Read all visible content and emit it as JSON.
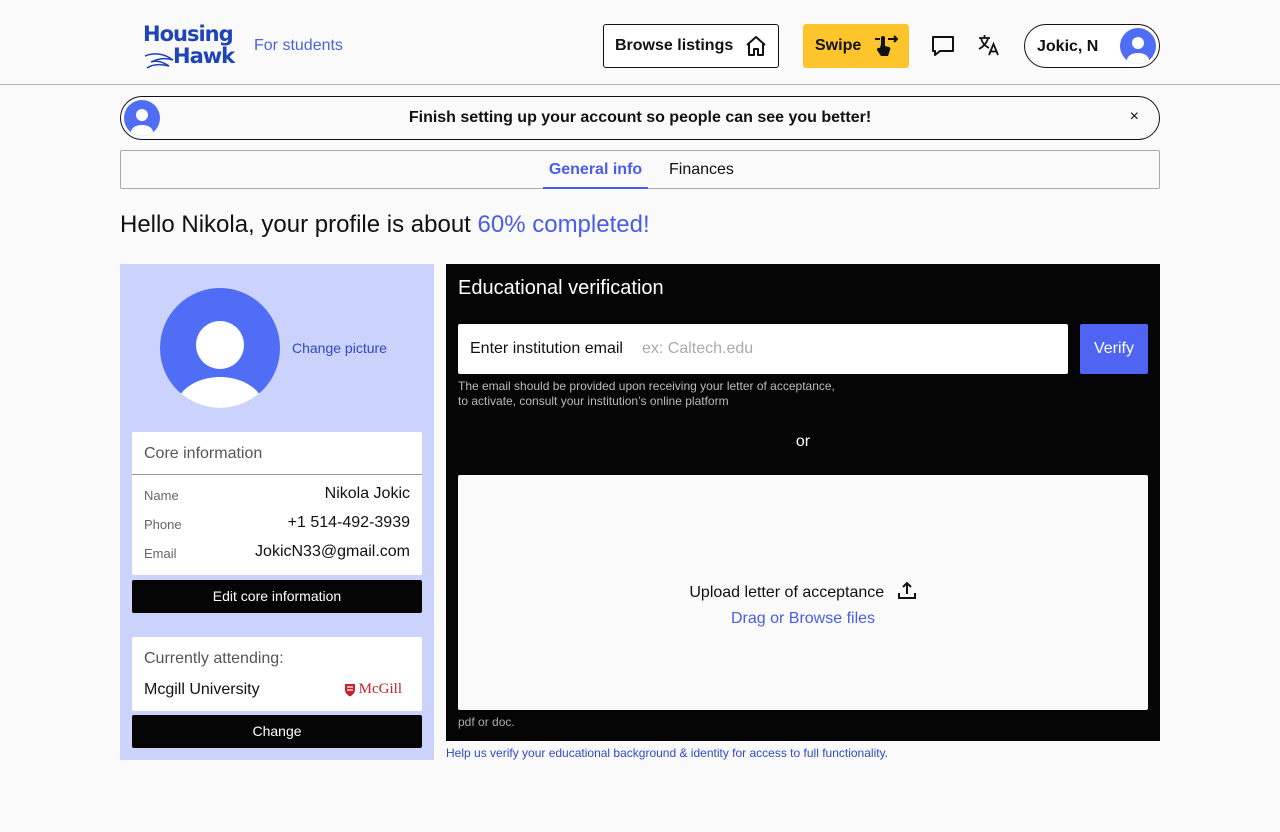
{
  "header": {
    "logo_line1": "Housing",
    "logo_line2": "Hawk",
    "tagline": "For students",
    "browse_label": "Browse listings",
    "swipe_label": "Swipe",
    "user_name": "Jokic, N"
  },
  "banner": {
    "text": "Finish setting up your account so people can see you better!",
    "close": "×"
  },
  "tabs": [
    {
      "label": "General info",
      "active": true
    },
    {
      "label": "Finances",
      "active": false
    }
  ],
  "greeting": {
    "prefix": "Hello Nikola, your profile is about ",
    "highlight": "60% completed!"
  },
  "profile": {
    "change_picture": "Change picture",
    "core_title": "Core information",
    "fields": [
      {
        "key": "Name",
        "value": "Nikola Jokic"
      },
      {
        "key": "Phone",
        "value": "+1 514-492-3939"
      },
      {
        "key": "Email",
        "value": "JokicN33@gmail.com"
      }
    ],
    "edit_button": "Edit core information",
    "attending_title": "Currently attending:",
    "university": "Mcgill University",
    "university_logo_text": "McGill",
    "change_button": "Change"
  },
  "verification": {
    "title": "Educational verification",
    "email_label": "Enter institution email",
    "email_placeholder": "ex: Caltech.edu",
    "verify_button": "Verify",
    "hint_line1": "The email should be provided upon receiving your letter of acceptance,",
    "hint_line2": "to activate, consult your institution’s online platform",
    "or": "or",
    "upload_label": "Upload letter of acceptance",
    "upload_link": "Drag or Browse files",
    "file_types": "pdf or doc.",
    "help_text": "Help us verify your educational background & identity for access to full functionality."
  },
  "colors": {
    "accent": "#4a5de8",
    "brand": "#1f44b8",
    "swipe": "#fdc42c",
    "panel_bg": "#cbd2fb",
    "mcgill_red": "#c8202f"
  },
  "icons": [
    "house-icon",
    "swipe-hand-icon",
    "chat-icon",
    "translate-icon",
    "user-avatar-icon",
    "close-icon",
    "upload-icon",
    "mcgill-crest-icon"
  ]
}
